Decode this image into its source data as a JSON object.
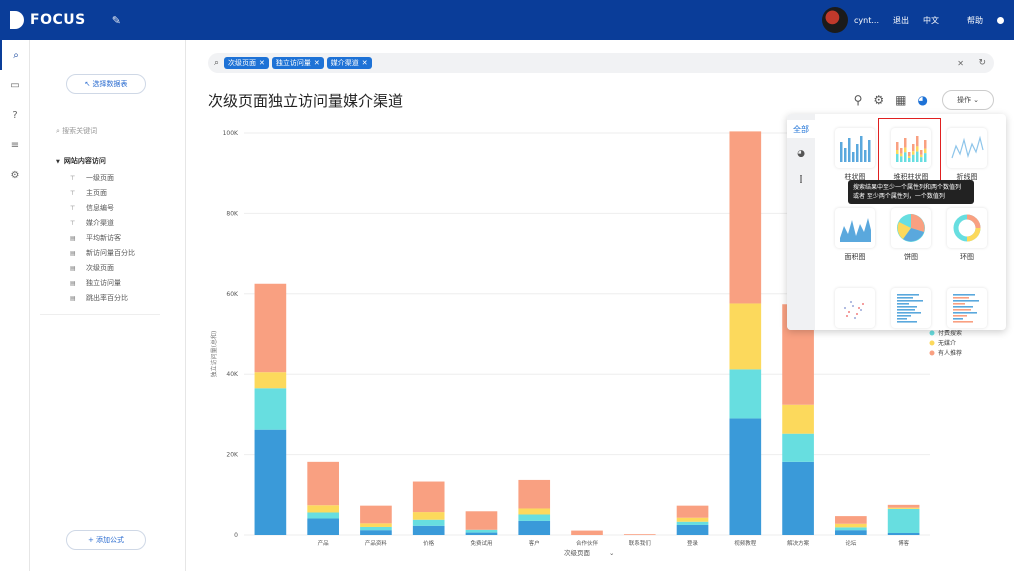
{
  "app": {
    "logo_text": "FOCUS",
    "user_name": "cynt...",
    "logout": "退出",
    "language": "中文",
    "help": "帮助"
  },
  "left_panel": {
    "select_table": "↖ 选择数据表",
    "keyword_placeholder": "搜索关键词",
    "group_title": "网站内容访问",
    "fields": [
      {
        "icon": "dimension-icon",
        "label": "一级页面"
      },
      {
        "icon": "dimension-icon",
        "label": "主页面"
      },
      {
        "icon": "dimension-icon",
        "label": "信息编号"
      },
      {
        "icon": "dimension-icon",
        "label": "媒介渠道"
      },
      {
        "icon": "measure-icon",
        "label": "平均新访客"
      },
      {
        "icon": "measure-icon",
        "label": "新访问量百分比"
      },
      {
        "icon": "measure-icon",
        "label": "次级页面"
      },
      {
        "icon": "measure-icon",
        "label": "独立访问量"
      },
      {
        "icon": "measure-icon",
        "label": "跳出率百分比"
      }
    ],
    "add_formula": "+ 添加公式"
  },
  "search": {
    "chips": [
      "次级页面",
      "独立访问量",
      "媒介渠道"
    ]
  },
  "chart_header": {
    "title": "次级页面独立访问量媒介渠道",
    "operate_label": "操作"
  },
  "chart_data": {
    "type": "bar",
    "stacked": true,
    "categories": [
      "",
      "产品",
      "产品资料",
      "价格",
      "免费试用",
      "客户",
      "合作伙伴",
      "联系我们",
      "登录",
      "视频教程",
      "解决方案",
      "论坛",
      "博客"
    ],
    "category_labels_shown": [
      "",
      "产品",
      "产品资料",
      "价格",
      "免费试用",
      "客户",
      "合作伙伴",
      "联系我们",
      "登录",
      "视频教程",
      "解决方案",
      "论坛",
      "博客"
    ],
    "series": [
      {
        "name": "",
        "color": "#3a9ad9",
        "values": [
          26200,
          4100,
          1200,
          2300,
          600,
          3500,
          0,
          0,
          2500,
          29000,
          18200,
          1200,
          500
        ]
      },
      {
        "name": "付费搜索",
        "color": "#67dee0",
        "values": [
          10300,
          1500,
          800,
          1500,
          700,
          1600,
          0,
          0,
          800,
          12200,
          7000,
          700,
          6000
        ]
      },
      {
        "name": "无媒介",
        "color": "#fcd95c",
        "values": [
          4000,
          1800,
          900,
          1900,
          0,
          1500,
          0,
          0,
          1000,
          16400,
          7200,
          900,
          300
        ]
      },
      {
        "name": "有人推荐",
        "color": "#f9a081",
        "values": [
          22000,
          10800,
          4400,
          7600,
          4600,
          7100,
          1100,
          200,
          3000,
          42800,
          25000,
          1900,
          700
        ]
      }
    ],
    "ylim": [
      0,
      100000
    ],
    "yticks": [
      "0",
      "20K",
      "40K",
      "60K",
      "80K",
      "100K"
    ],
    "xlabel": "次级页面",
    "ylabel": "独立访问量(总和)",
    "legend_items": [
      "付费搜索",
      "无媒介",
      "有人推荐"
    ]
  },
  "chart_popup": {
    "tab_all": "全部",
    "chart_types": [
      {
        "label": "柱状图"
      },
      {
        "label": "堆积柱状图"
      },
      {
        "label": "折线图"
      },
      {
        "label": "面积图"
      },
      {
        "label": "饼图"
      },
      {
        "label": "环图"
      },
      {
        "label": ""
      },
      {
        "label": ""
      },
      {
        "label": ""
      }
    ],
    "tooltip_line1": "搜索结果中至少一个属性列和两个数值列",
    "tooltip_line2": "或者 至少两个属性列，一个数值列"
  }
}
